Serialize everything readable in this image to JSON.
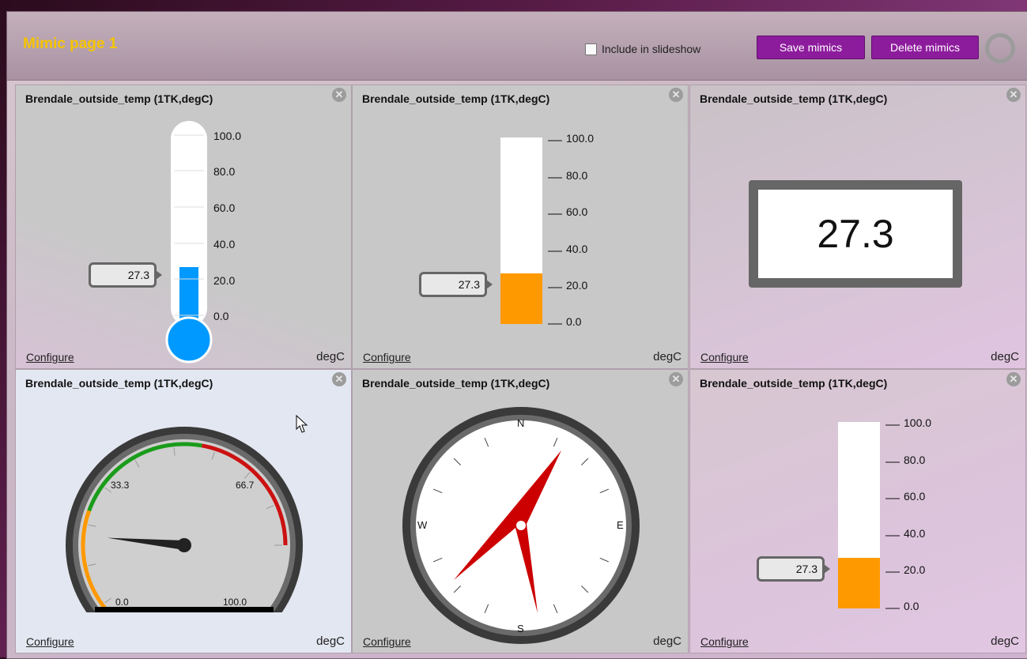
{
  "page": {
    "title": "Mimic page 1",
    "slideshow_label": "Include in slideshow",
    "save_label": "Save mimics",
    "delete_label": "Delete mimics"
  },
  "panels": [
    {
      "title": "Brendale_outside_temp (1TK,degC)",
      "configure": "Configure",
      "unit": "degC",
      "type": "thermometer",
      "value": "27.3",
      "ticks": [
        "100.0",
        "80.0",
        "60.0",
        "40.0",
        "20.0",
        "0.0"
      ]
    },
    {
      "title": "Brendale_outside_temp (1TK,degC)",
      "configure": "Configure",
      "unit": "degC",
      "type": "bar",
      "value": "27.3",
      "ticks": [
        "100.0",
        "80.0",
        "60.0",
        "40.0",
        "20.0",
        "0.0"
      ]
    },
    {
      "title": "Brendale_outside_temp (1TK,degC)",
      "configure": "Configure",
      "unit": "degC",
      "type": "numeric",
      "value": "27.3"
    },
    {
      "title": "Brendale_outside_temp (1TK,degC)",
      "configure": "Configure",
      "unit": "degC",
      "type": "dial",
      "value": "27.3",
      "labels": [
        "33.3",
        "66.7",
        "0.0",
        "100.0"
      ]
    },
    {
      "title": "Brendale_outside_temp (1TK,degC)",
      "configure": "Configure",
      "unit": "degC",
      "type": "compass",
      "labels": [
        "N",
        "E",
        "S",
        "W"
      ]
    },
    {
      "title": "Brendale_outside_temp (1TK,degC)",
      "configure": "Configure",
      "unit": "degC",
      "type": "bar",
      "value": "27.3",
      "ticks": [
        "100.0",
        "80.0",
        "60.0",
        "40.0",
        "20.0",
        "0.0"
      ]
    }
  ],
  "gauge": {
    "min": 0,
    "max": 100,
    "value": 27.3
  },
  "colors": {
    "title_accent": "#f5c400",
    "button": "#8d1c9d",
    "thermo_fill": "#0099ff",
    "bar_fill": "#ff9900",
    "compass_needle": "#cc0000",
    "dial_green": "#1a9c1a",
    "dial_red": "#cc1111",
    "dial_orange": "#ff9900"
  },
  "icons": {
    "close": "close-circle-icon",
    "spinner": "loading-ring-icon",
    "cursor": "mouse-pointer-icon"
  }
}
